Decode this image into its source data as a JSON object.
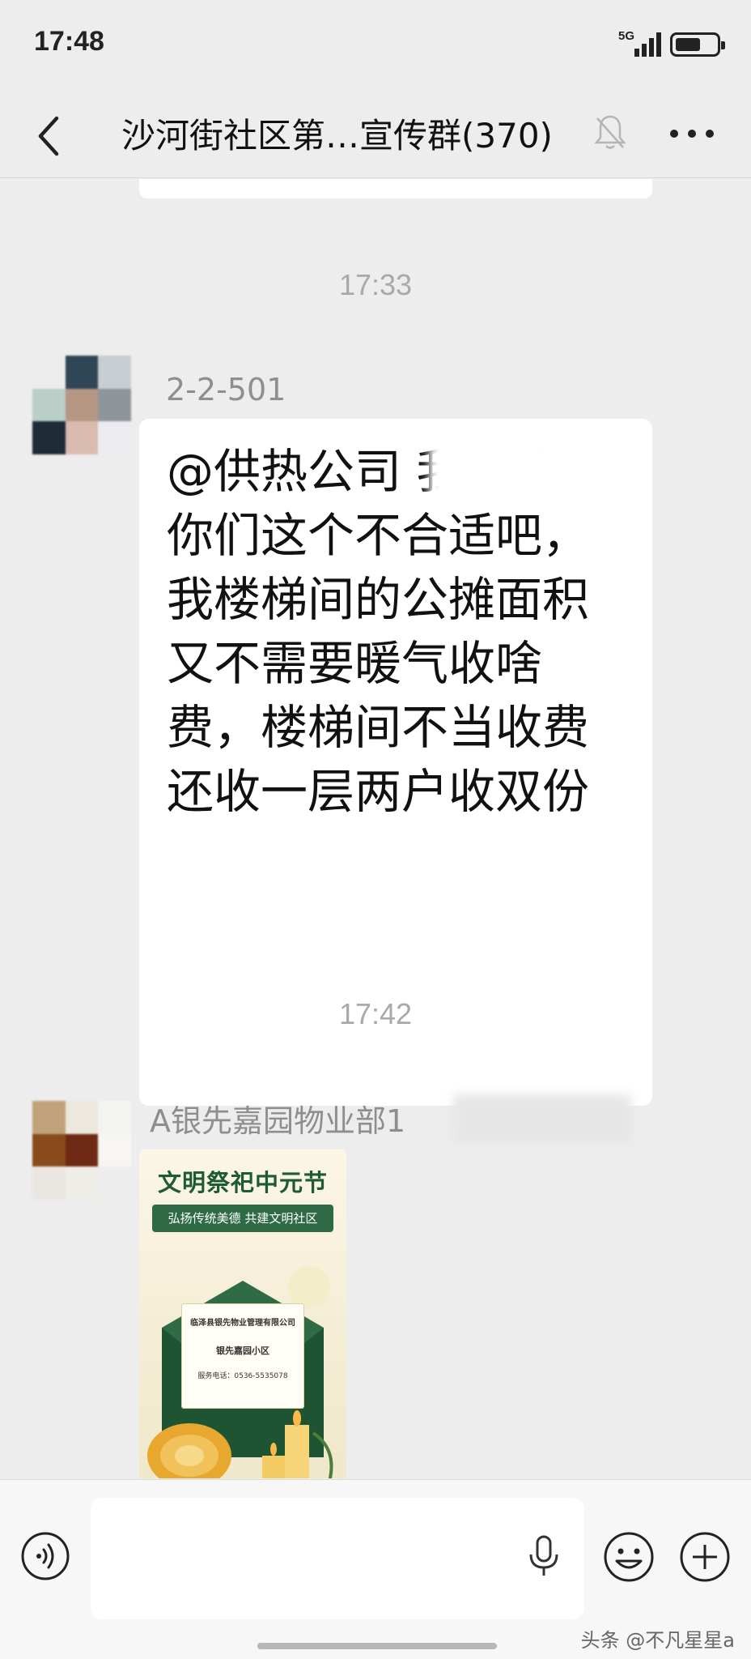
{
  "status_bar": {
    "time": "17:48",
    "network": "5G",
    "icons": [
      "signal-icon",
      "battery-icon"
    ]
  },
  "nav": {
    "title": "沙河街社区第…宣传群(370)",
    "icons": [
      "back-icon",
      "mute-bell-icon",
      "more-icon"
    ]
  },
  "messages": [
    {
      "timestamp": "17:33",
      "sender": "2-2-501",
      "text": "@供热公司 我就感觉你们这个不合适吧，我楼梯间的公摊面积又不需要暖气收啥费，楼梯间不当收费还收一层两户收双份"
    },
    {
      "timestamp": "17:42",
      "sender": "A银先嘉园物业部1",
      "image": {
        "title": "文明祭祀中元节",
        "subtitle": "弘扬传统美德 共建文明社区",
        "company": "临泽县银先物业管理有限公司",
        "community": "银先嘉园小区",
        "phone": "服务电话：0536-5535078"
      }
    }
  ],
  "input_bar": {
    "icons": [
      "voice-icon",
      "mic-icon",
      "emoji-icon",
      "plus-icon"
    ],
    "placeholder": ""
  },
  "watermark": "头条 @不凡星星a",
  "colors": {
    "background": "#ededed",
    "bubble": "#ffffff",
    "timestamp": "#a9a9a9",
    "poster_green": "#2e6b44"
  }
}
